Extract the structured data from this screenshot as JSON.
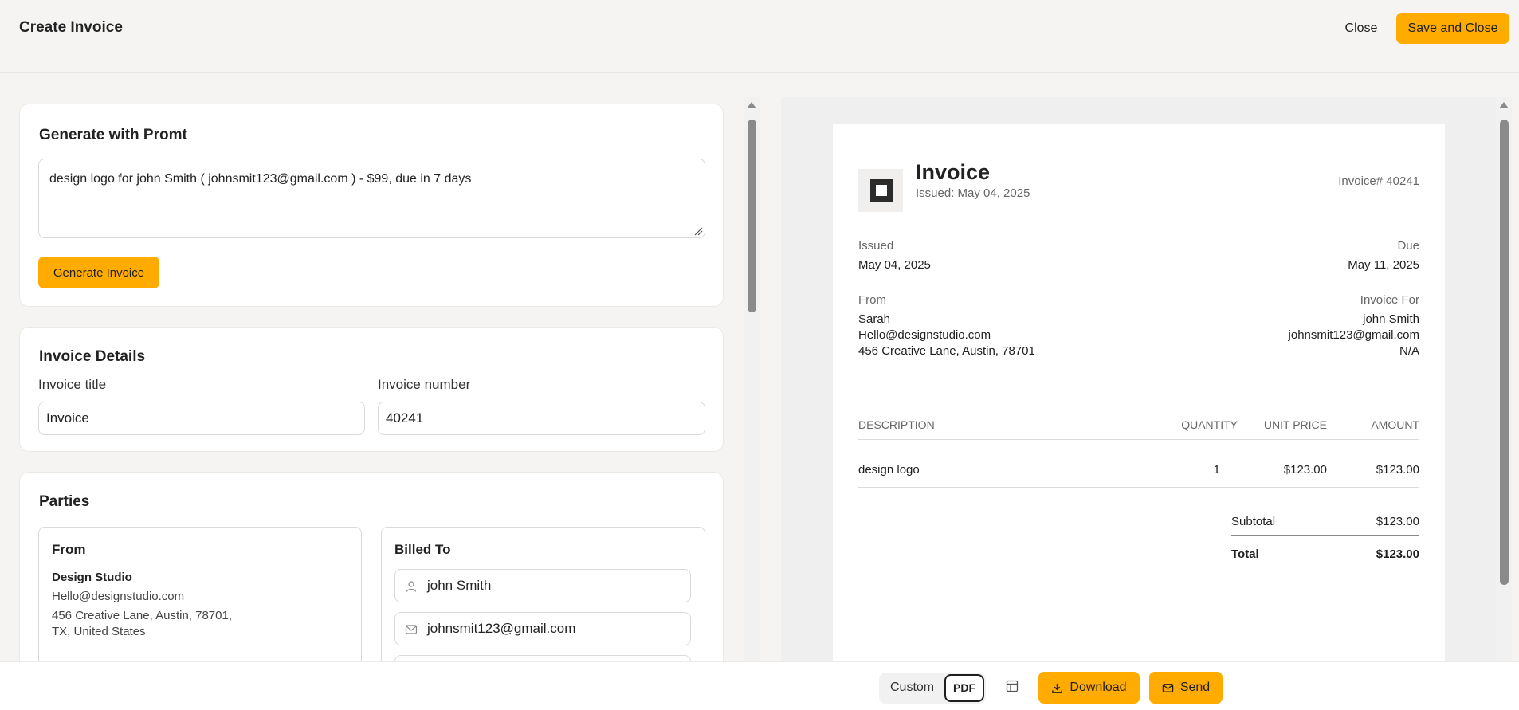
{
  "header": {
    "title": "Create Invoice",
    "close_label": "Close",
    "save_close_label": "Save and Close"
  },
  "prompt_card": {
    "heading": "Generate with Promt",
    "prompt_text": "design logo for john Smith ( johnsmit123@gmail.com ) - $99, due in 7 days",
    "generate_label": "Generate Invoice"
  },
  "details_card": {
    "heading": "Invoice Details",
    "title_label": "Invoice title",
    "title_value": "Invoice",
    "number_label": "Invoice number",
    "number_value": "40241"
  },
  "parties_card": {
    "heading": "Parties",
    "from": {
      "heading": "From",
      "name": "Design Studio",
      "email": "Hello@designstudio.com",
      "address_line1": "456 Creative Lane, Austin, 78701,",
      "address_line2": "TX, United States"
    },
    "billed_to": {
      "heading": "Billed To",
      "name_value": "john Smith",
      "email_value": "johnsmit123@gmail.com"
    }
  },
  "preview": {
    "title": "Invoice",
    "issued_sub": "Issued: May 04, 2025",
    "invoice_no": "Invoice# 40241",
    "issued_label": "Issued",
    "issued_value": "May 04, 2025",
    "due_label": "Due",
    "due_value": "May 11, 2025",
    "from_label": "From",
    "from_name": "Sarah",
    "from_email": "Hello@designstudio.com",
    "from_address": "456 Creative Lane, Austin, 78701",
    "for_label": "Invoice For",
    "for_name": "john Smith",
    "for_email": "johnsmit123@gmail.com",
    "for_address": "N/A",
    "table": {
      "headers": [
        "DESCRIPTION",
        "QUANTITY",
        "UNIT PRICE",
        "AMOUNT"
      ],
      "rows": [
        {
          "description": "design logo",
          "quantity": "1",
          "unit_price": "$123.00",
          "amount": "$123.00"
        }
      ]
    },
    "subtotal_label": "Subtotal",
    "subtotal_value": "$123.00",
    "total_label": "Total",
    "total_value": "$123.00"
  },
  "bottombar": {
    "custom_label": "Custom",
    "pdf_label": "PDF",
    "download_label": "Download",
    "send_label": "Send"
  },
  "colors": {
    "accent": "#ffab00",
    "background": "#f5f4f3"
  }
}
